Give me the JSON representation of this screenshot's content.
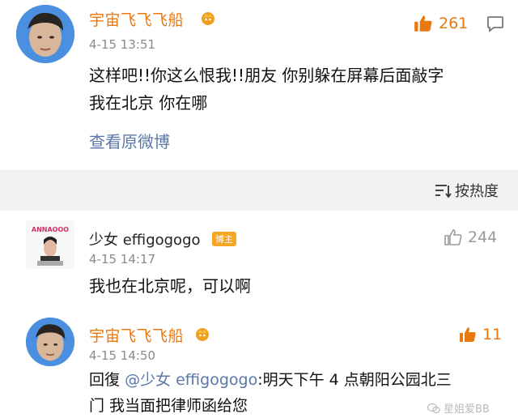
{
  "comment_top": {
    "username": "宇宙飞飞飞船",
    "timestamp": "4-15 13:51",
    "likes": "261",
    "text_line1": "这样吧!!你这么恨我!!朋友 你别躲在屏幕后面敲字",
    "text_line2": "我在北京 你在哪",
    "view_original": "查看原微博"
  },
  "sort_bar": {
    "label": "按热度"
  },
  "reply_1": {
    "username": "少女 effigogogo",
    "badge": "博主",
    "avatar_text": "ANNAOOO",
    "timestamp": "4-15 14:17",
    "likes": "244",
    "text": "我也在北京呢，可以啊"
  },
  "reply_2": {
    "username": "宇宙飞飞飞船",
    "timestamp": "4-15 14:50",
    "likes": "11",
    "reply_prefix": "回復",
    "mention": "@少女 effigogogo",
    "text_rest": ":明天下午 4 点朝阳公园北三",
    "text_line2": "门 我当面把律师函给您"
  },
  "watermark": "星姐爱BB",
  "colors": {
    "username_orange": "#e8780f",
    "link_blue": "#5a77a8",
    "badge_orange": "#f5a623",
    "like_orange": "#e8780f",
    "like_gray": "#9a9a9a"
  }
}
